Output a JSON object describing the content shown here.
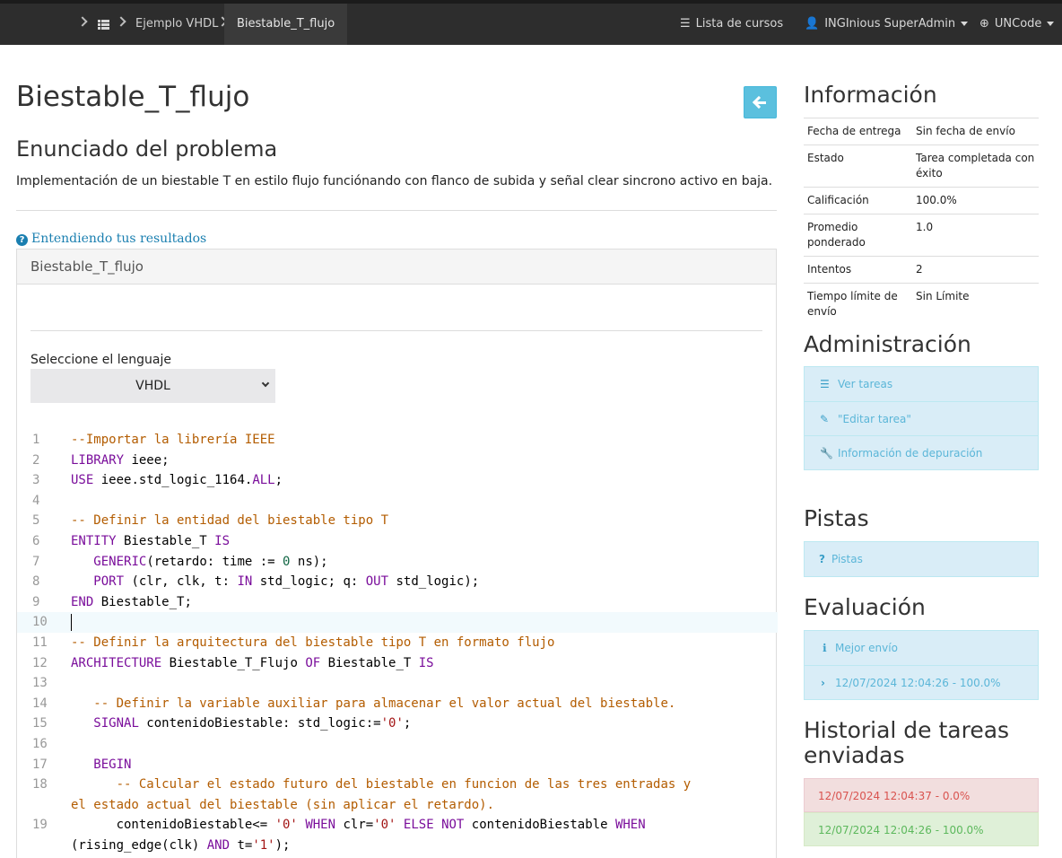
{
  "nav": {
    "breadcrumb": [
      "Ejemplo VHDL",
      "Biestable_T_flujo"
    ],
    "courses_label": "Lista de cursos",
    "user_label": "INGInious SuperAdmin",
    "org_label": "UNCode"
  },
  "task": {
    "title": "Biestable_T_flujo",
    "statement_heading": "Enunciado del problema",
    "statement": "Implementación de un biestable T en estilo flujo funciónando con flanco de subida y señal clear sincrono activo en baja.",
    "help_link": "Entendiendo tus resultados",
    "panel_title": "Biestable_T_flujo",
    "language_label": "Seleccione el lenguaje",
    "language_value": "VHDL"
  },
  "code_lines": [
    {
      "n": "1",
      "t": "--Importar la librería IEEE"
    },
    {
      "n": "2",
      "t": "LIBRARY ieee;"
    },
    {
      "n": "3",
      "t": "USE ieee.std_logic_1164.ALL;"
    },
    {
      "n": "4",
      "t": ""
    },
    {
      "n": "5",
      "t": "-- Definir la entidad del biestable tipo T"
    },
    {
      "n": "6",
      "t": "ENTITY Biestable_T IS"
    },
    {
      "n": "7",
      "t": "   GENERIC(retardo: time := 0 ns);"
    },
    {
      "n": "8",
      "t": "   PORT (clr, clk, t: IN std_logic; q: OUT std_logic);"
    },
    {
      "n": "9",
      "t": "END Biestable_T;"
    },
    {
      "n": "10",
      "t": ""
    },
    {
      "n": "11",
      "t": "-- Definir la arquitectura del biestable tipo T en formato flujo"
    },
    {
      "n": "12",
      "t": "ARCHITECTURE Biestable_T_Flujo OF Biestable_T IS"
    },
    {
      "n": "13",
      "t": ""
    },
    {
      "n": "14",
      "t": "   -- Definir la variable auxiliar para almacenar el valor actual del biestable."
    },
    {
      "n": "15",
      "t": "   SIGNAL contenidoBiestable: std_logic:='0';"
    },
    {
      "n": "16",
      "t": ""
    },
    {
      "n": "17",
      "t": "   BEGIN"
    },
    {
      "n": "18",
      "t": "      -- Calcular el estado futuro del biestable en funcion de las tres entradas y"
    },
    {
      "n": "",
      "t": "el estado actual del biestable (sin aplicar el retardo)."
    },
    {
      "n": "19",
      "t": "      contenidoBiestable<= '0' WHEN clr='0' ELSE NOT contenidoBiestable WHEN"
    },
    {
      "n": "",
      "t": "(rising_edge(clk) AND t='1');"
    }
  ],
  "sidebar": {
    "info_heading": "Información",
    "info_rows": [
      {
        "key": "Fecha de entrega",
        "value": "Sin fecha de envío"
      },
      {
        "key": "Estado",
        "value": "Tarea completada con éxito"
      },
      {
        "key": "Calificación",
        "value": "100.0%"
      },
      {
        "key": "Promedio ponderado",
        "value": "1.0"
      },
      {
        "key": "Intentos",
        "value": "2"
      },
      {
        "key": "Tiempo límite de envío",
        "value": "Sin Límite"
      }
    ],
    "admin_heading": "Administración",
    "admin_items": [
      "Ver tareas",
      "\"Editar tarea\"",
      "Información de depuración"
    ],
    "hints_heading": "Pistas",
    "hints_item": "Pistas",
    "eval_heading": "Evaluación",
    "eval_items": [
      "Mejor envío",
      "12/07/2024 12:04:26 - 100.0%"
    ],
    "history_heading": "Historial de tareas enviadas",
    "history_items": [
      {
        "label": "12/07/2024 12:04:37 - 0.0%",
        "status": "failed",
        "color": "#f2dede",
        "text_color": "#d9534f"
      },
      {
        "label": "12/07/2024 12:04:26 - 100.0%",
        "status": "success",
        "color": "#dff0d8",
        "text_color": "#5cb85c"
      }
    ]
  },
  "colors": {
    "navbar": "#2d2d2d",
    "info_accent": "#5bc0de",
    "keyword": "#7a0e9b",
    "comment": "#b35c00"
  }
}
